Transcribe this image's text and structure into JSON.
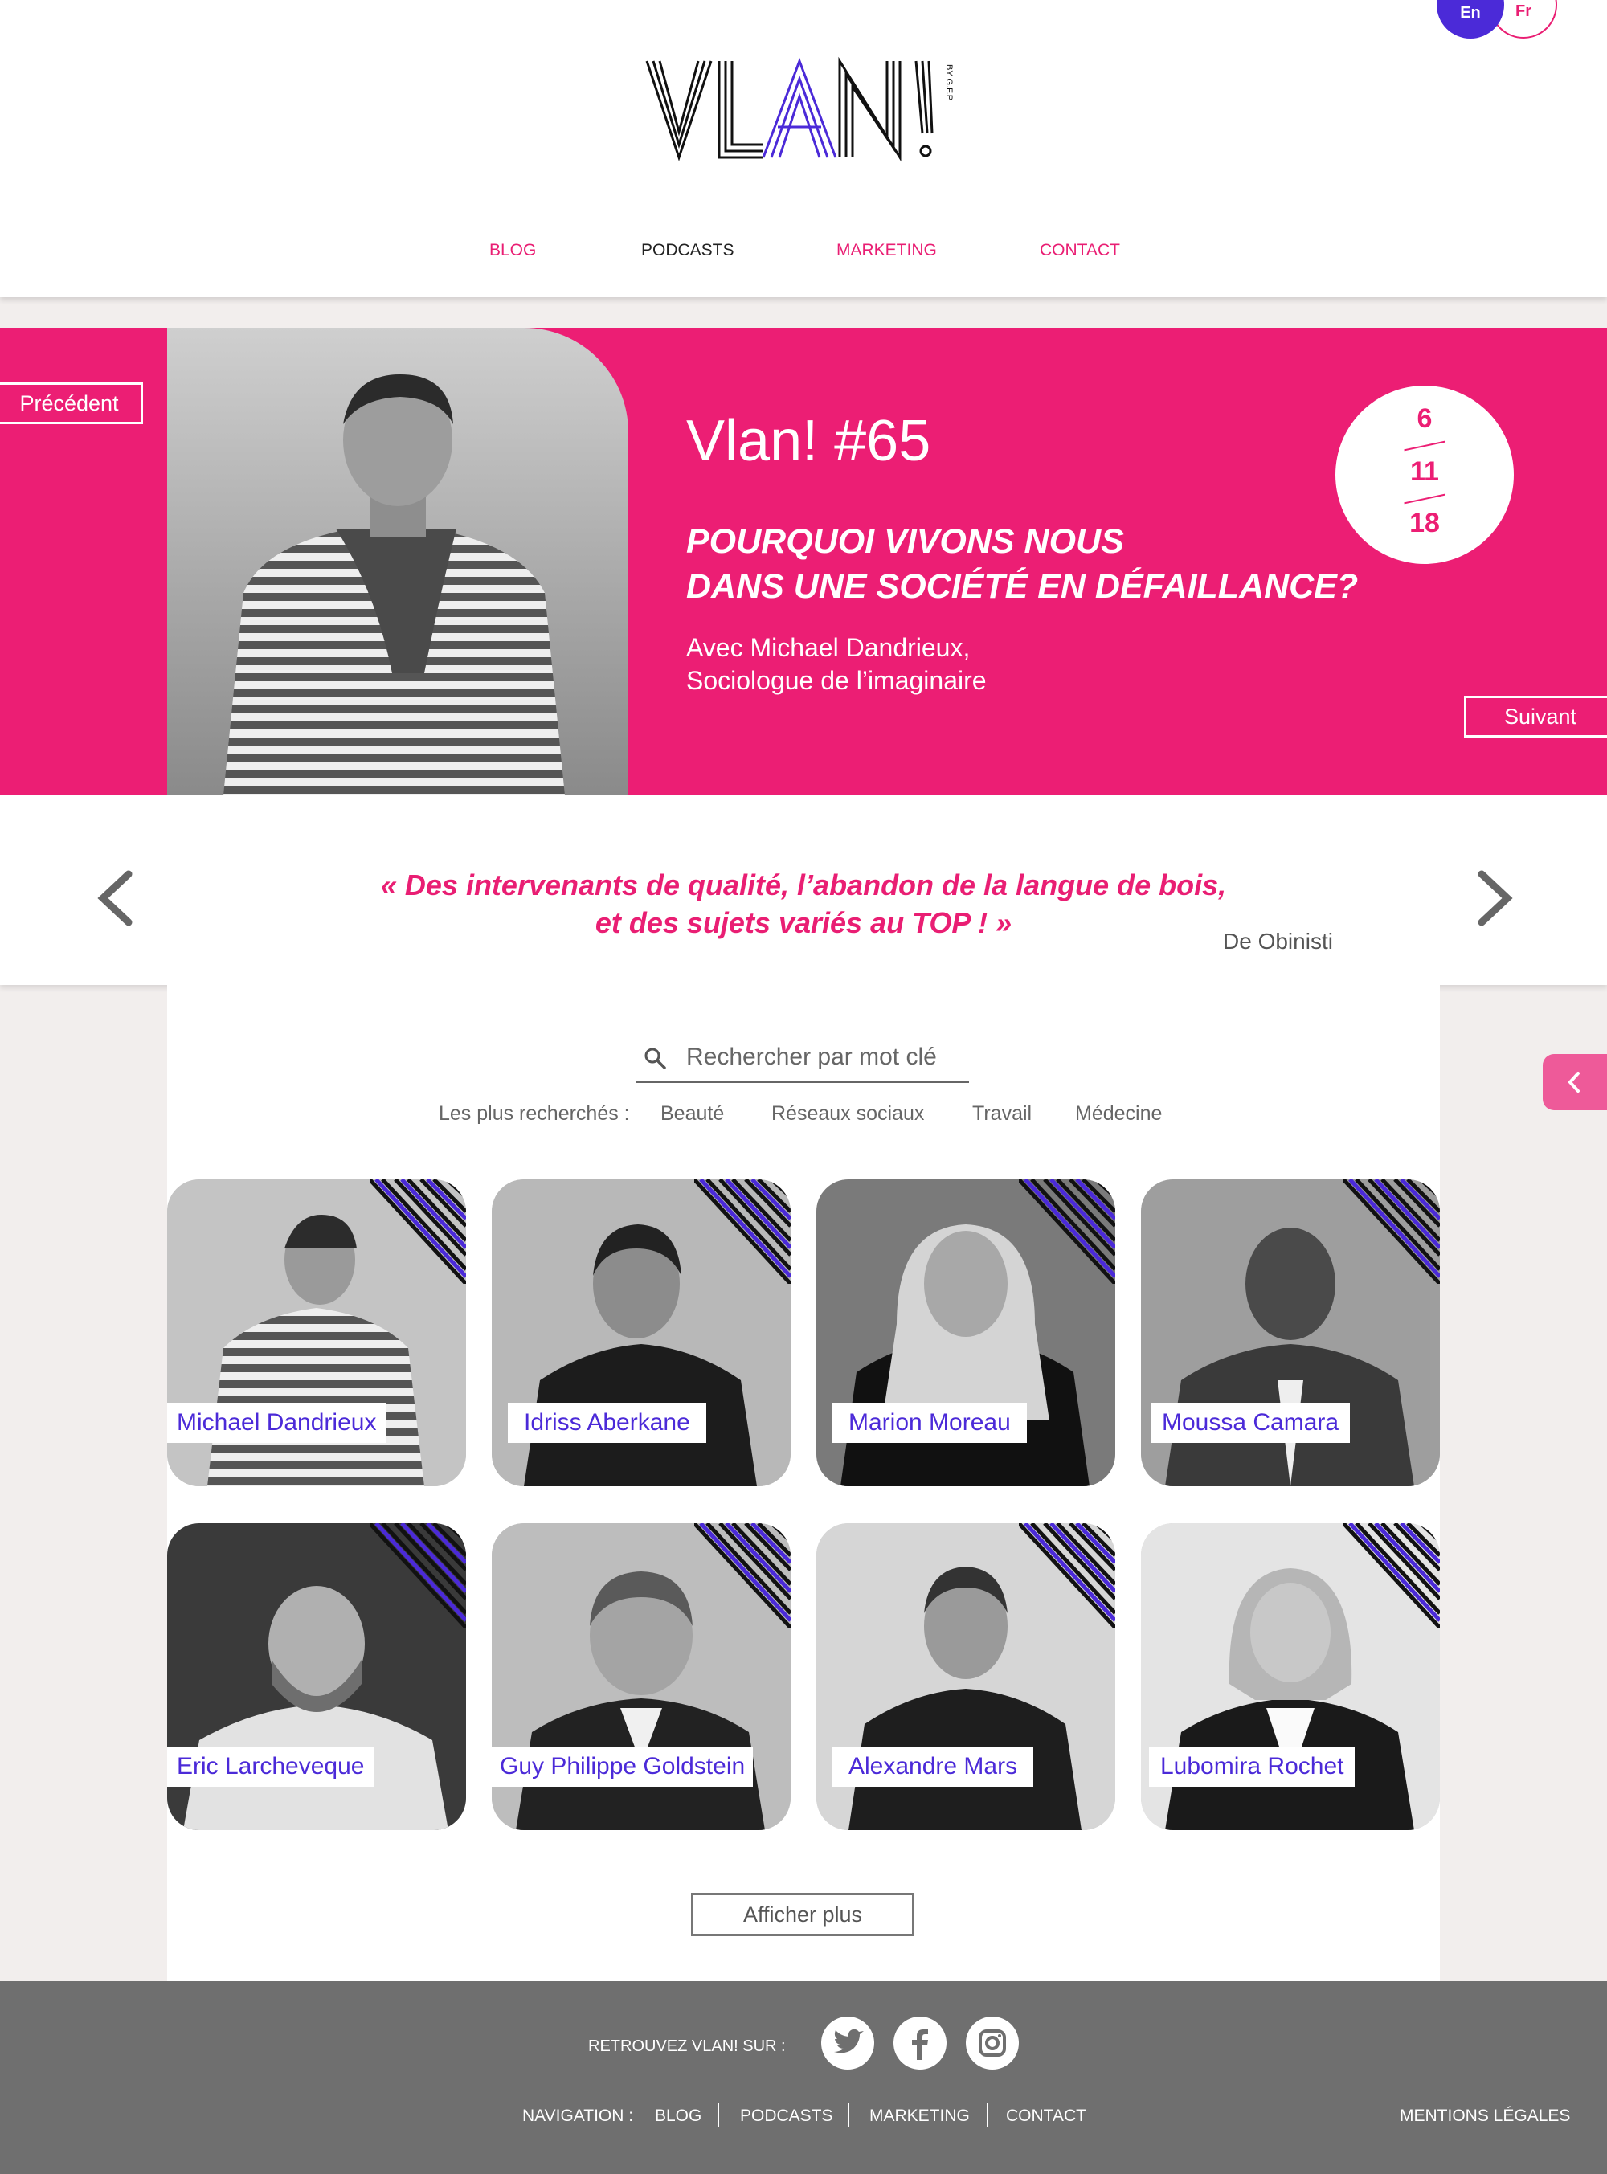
{
  "header": {
    "lang": {
      "en": "En",
      "fr": "Fr"
    },
    "logo_text": "VLAN!",
    "logo_sub": "BY G.F.P",
    "nav": [
      {
        "label": "BLOG",
        "active": false
      },
      {
        "label": "PODCASTS",
        "active": true
      },
      {
        "label": "MARKETING",
        "active": false
      },
      {
        "label": "CONTACT",
        "active": false
      }
    ]
  },
  "hero": {
    "prev_label": "Précédent",
    "next_label": "Suivant",
    "episode": "Vlan! #65",
    "title_line1": "POURQUOI VIVONS NOUS",
    "title_line2": "DANS UNE SOCIÉTÉ EN DÉFAILLANCE?",
    "guest_line1": "Avec Michael Dandrieux,",
    "guest_line2": "Sociologue de l’imaginaire",
    "date": {
      "day": "6",
      "month": "11",
      "year": "18"
    },
    "accent_color": "#ec1e74"
  },
  "testimonial": {
    "line1": "« Des intervenants de qualité, l’abandon de la langue de bois,",
    "line2": "et des sujets variés au TOP ! »",
    "author": "De Obinisti"
  },
  "search": {
    "placeholder": "Rechercher par mot clé",
    "popular_label": "Les plus recherchés :",
    "popular": [
      "Beauté",
      "Réseaux sociaux",
      "Travail",
      "Médecine"
    ]
  },
  "guests": [
    "Michael Dandrieux",
    "Idriss Aberkane",
    "Marion Moreau",
    "Moussa Camara",
    "Eric Larcheveque",
    "Guy Philippe Goldstein",
    "Alexandre Mars",
    "Lubomira Rochet"
  ],
  "more_label": "Afficher plus",
  "footer": {
    "follow_label": "RETROUVEZ VLAN! SUR :",
    "social": [
      "twitter-icon",
      "facebook-icon",
      "instagram-icon"
    ],
    "nav_label": "NAVIGATION :",
    "nav": [
      "BLOG",
      "PODCASTS",
      "MARKETING",
      "CONTACT"
    ],
    "legal": "MENTIONS LÉGALES"
  },
  "colors": {
    "pink": "#ec1e74",
    "violet": "#4b2ad8",
    "footer_gray": "#6f6f6f"
  }
}
